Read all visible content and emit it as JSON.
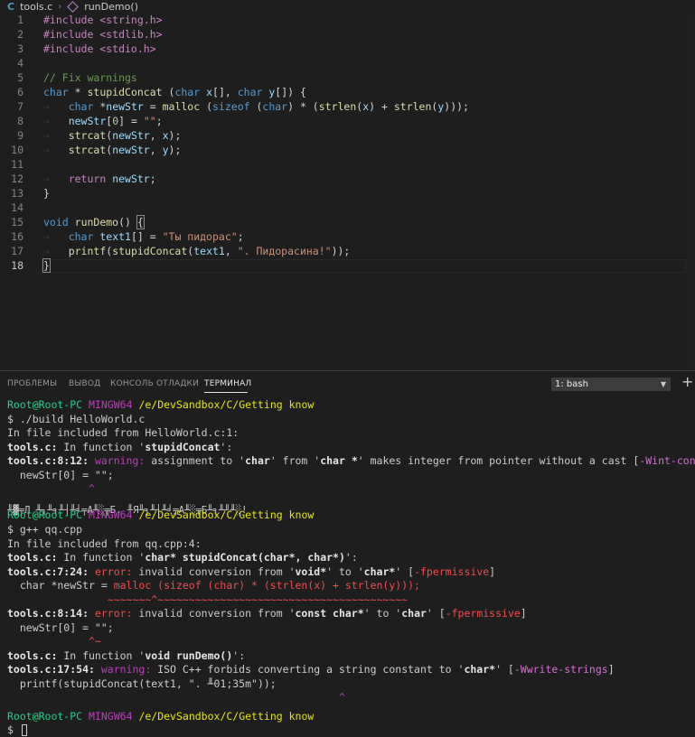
{
  "breadcrumb": {
    "file_icon": "C",
    "file": "tools.c",
    "symbol": "runDemo()"
  },
  "editor": {
    "includes": [
      "#include <string.h>",
      "#include <stdlib.h>",
      "#include <stdio.h>"
    ],
    "comment": "// Fix warnings",
    "l6": {
      "t1": "char",
      "t2": " * ",
      "fn": "stupidConcat",
      "t3": " (",
      "t4": "char",
      "t5": " ",
      "v1": "x",
      "t6": "[], ",
      "t7": "char",
      "t8": " ",
      "v2": "y",
      "t9": "[]) {"
    },
    "l7": {
      "t1": "char",
      "t2": " *",
      "v1": "newStr",
      "t3": " = ",
      "fn": "malloc",
      "t4": " (",
      "k1": "sizeof",
      "t5": " (",
      "k2": "char",
      "t6": ") * (",
      "fn2": "strlen",
      "t7": "(",
      "v2": "x",
      "t8": ") + ",
      "fn3": "strlen",
      "t9": "(",
      "v3": "y",
      "t10": ")));"
    },
    "l8": {
      "v": "newStr",
      "t1": "[",
      "n": "0",
      "t2": "] = ",
      "s": "\"\"",
      "t3": ";"
    },
    "l9": {
      "fn": "strcat",
      "t1": "(",
      "v1": "newStr",
      "t2": ", ",
      "v2": "x",
      "t3": ");"
    },
    "l10": {
      "fn": "strcat",
      "t1": "(",
      "v1": "newStr",
      "t2": ", ",
      "v2": "y",
      "t3": ");"
    },
    "l12": {
      "k": "return",
      "t1": " ",
      "v": "newStr",
      "t2": ";"
    },
    "l13": "}",
    "l15": {
      "k": "void",
      "t1": " ",
      "fn": "runDemo",
      "t2": "() ",
      "brace": "{"
    },
    "l16": {
      "k": "char",
      "t1": " ",
      "v": "text1",
      "t2": "[] = ",
      "s": "\"Ты пидорас\"",
      "t3": ";"
    },
    "l17": {
      "fn": "printf",
      "t1": "(",
      "fn2": "stupidConcat",
      "t2": "(",
      "v": "text1",
      "t3": ", ",
      "s": "\". Пидорасина!\"",
      "t4": "));"
    },
    "l18": "}",
    "line_numbers": [
      "1",
      "2",
      "3",
      "4",
      "5",
      "6",
      "7",
      "8",
      "9",
      "10",
      "11",
      "12",
      "13",
      "14",
      "15",
      "16",
      "17",
      "18"
    ]
  },
  "panel": {
    "tabs": [
      "ПРОБЛЕМЫ",
      "ВЫВОД",
      "КОНСОЛЬ ОТЛАДКИ",
      "ТЕРМИНАЛ"
    ],
    "terminal_select": "1: bash"
  },
  "terminal": {
    "prompt": {
      "user": "Root@Root-PC",
      "env": "MINGW64",
      "path": "/e/DevSandbox/C/Getting know"
    },
    "cmd1": "$ ./build HelloWorld.c",
    "l3": "In file included from HelloWorld.c:1:",
    "l4": {
      "a": "tools.c:",
      "b": " In function '",
      "c": "stupidConcat",
      "d": "':"
    },
    "l5": {
      "a": "tools.c:8:12: ",
      "b": "warning: ",
      "c": "assignment to '",
      "d": "char",
      "e": "' from '",
      "f": "char *",
      "g": "' makes integer from pointer without a cast [",
      "h": "-Wint-conversion",
      "i": "]"
    },
    "l6": "  newStr[0] = \"\";",
    "l7": "             ^",
    "l8": "╨▓╤Л ╨┐╨╕╨┤╨╛╤А╨░╤Б. ╨Я╨╕╨┤╨╛╤А╨░╤Б╨╕╨╜╨░!",
    "cmd2": "$ g++ qq.cpp",
    "l11": "In file included from qq.cpp:4:",
    "l12": {
      "a": "tools.c:",
      "b": " In function '",
      "c": "char* stupidConcat(char*, char*)",
      "d": "':"
    },
    "l13": {
      "a": "tools.c:7:24: ",
      "b": "error: ",
      "c": "invalid conversion from '",
      "d": "void*",
      "e": "' to '",
      "f": "char*",
      "g": "' [",
      "h": "-fpermissive",
      "i": "]"
    },
    "l14": {
      "a": "  char *newStr = ",
      "b": "malloc (sizeof (char) * (strlen(x) + strlen(y)));"
    },
    "l15": "                ~~~~~~~^~~~~~~~~~~~~~~~~~~~~~~~~~~~~~~~~~~~~~~~~",
    "l16": {
      "a": "tools.c:8:14: ",
      "b": "error: ",
      "c": "invalid conversion from '",
      "d": "const char*",
      "e": "' to '",
      "f": "char",
      "g": "' [",
      "h": "-fpermissive",
      "i": "]"
    },
    "l17": "  newStr[0] = \"\";",
    "l18": "             ^~",
    "l19": {
      "a": "tools.c:",
      "b": " In function '",
      "c": "void runDemo()",
      "d": "':"
    },
    "l20": {
      "a": "tools.c:17:54: ",
      "b": "warning: ",
      "c": "ISO C++ forbids converting a string constant to '",
      "d": "char*",
      "e": "' [",
      "f": "-Wwrite-strings",
      "g": "]"
    },
    "l21": "  printf(stupidConcat(text1, \". ╨01;35m\"));",
    "l22": "                                                     ^",
    "cmd3": "$ "
  }
}
